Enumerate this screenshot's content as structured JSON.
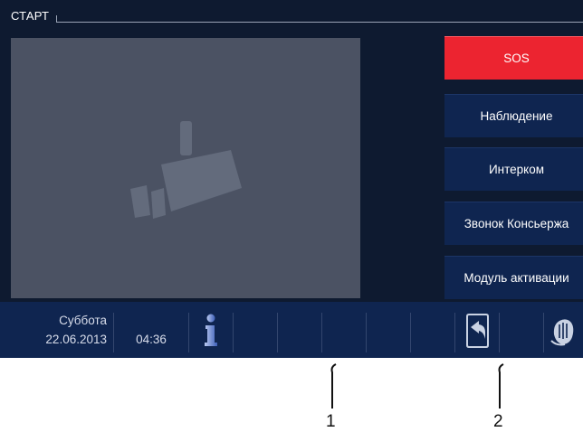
{
  "screen": {
    "title": "СТАРТ",
    "video_area": {
      "icon": "camera-icon"
    }
  },
  "sidebar": {
    "buttons": [
      {
        "label": "SOS",
        "color": "#ec2430"
      },
      {
        "label": "Наблюдение"
      },
      {
        "label": "Интерком"
      },
      {
        "label": "Звонок Консьержа"
      },
      {
        "label": "Модуль активации"
      }
    ]
  },
  "statusbar": {
    "weekday": "Суббота",
    "date": "22.06.2013",
    "time": "04:36",
    "icons": [
      "info-icon",
      "return-call-icon",
      "cleaning-hand-icon"
    ]
  },
  "callouts": [
    "1",
    "2"
  ],
  "colors": {
    "background": "#0e1a30",
    "panel": "#0f2550",
    "video_placeholder": "#4b5263",
    "sos": "#ec2430"
  }
}
